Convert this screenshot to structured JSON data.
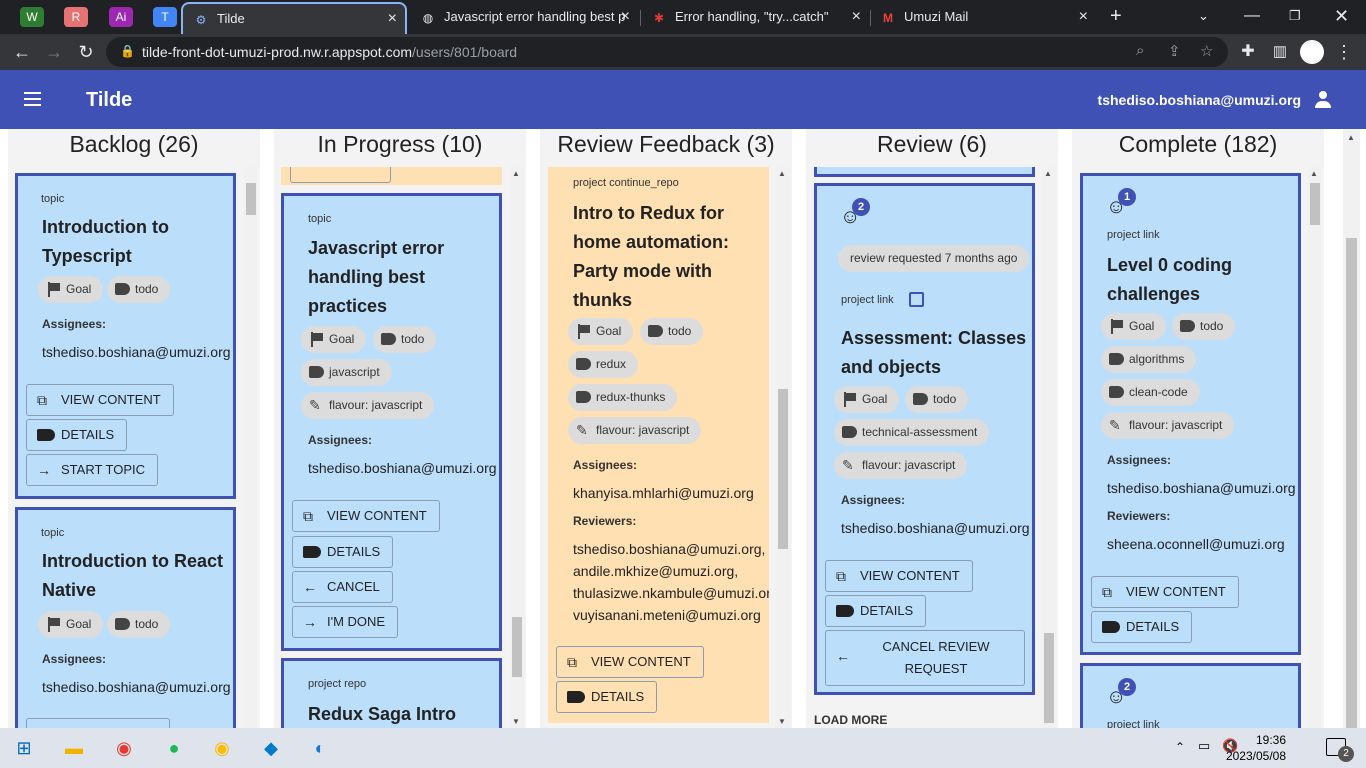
{
  "browser": {
    "pinned_tabs": [
      {
        "label": "W",
        "color": "#2e7d32"
      },
      {
        "label": "R",
        "color": "#e57373"
      },
      {
        "label": "Ai",
        "color": "#9c27b0"
      },
      {
        "label": "T",
        "color": "#4285f4"
      }
    ],
    "tabs": [
      {
        "title": "Tilde",
        "active": true
      },
      {
        "title": "Javascript error handling best p",
        "active": false
      },
      {
        "title": "Error handling, \"try...catch\"",
        "active": false
      },
      {
        "title": "Umuzi Mail",
        "active": false
      }
    ],
    "url_host": "tilde-front-dot-umuzi-prod.nw.r.appspot.com",
    "url_path": "/users/801/board"
  },
  "app": {
    "title": "Tilde",
    "user_email": "tshediso.boshiana@umuzi.org"
  },
  "columns": [
    {
      "title": "Backlog (26)"
    },
    {
      "title": "In Progress (10)"
    },
    {
      "title": "Review Feedback (3)"
    },
    {
      "title": "Review (6)"
    },
    {
      "title": "Complete (182)"
    }
  ],
  "backlog": [
    {
      "type": "topic",
      "title": "Introduction to Typescript",
      "tags": [
        "Goal",
        "todo"
      ],
      "assignees_label": "Assignees:",
      "assignees": "tshediso.boshiana@umuzi.org",
      "buttons": [
        "VIEW CONTENT",
        "DETAILS",
        "START TOPIC"
      ]
    },
    {
      "type": "topic",
      "title": "Introduction to React Native",
      "tags": [
        "Goal",
        "todo"
      ],
      "assignees_label": "Assignees:",
      "assignees": "tshediso.boshiana@umuzi.org"
    }
  ],
  "in_progress": [
    {
      "type": "topic",
      "title": "Javascript error handling best practices",
      "tags": [
        "Goal",
        "todo",
        "javascript",
        "flavour: javascript"
      ],
      "assignees_label": "Assignees:",
      "assignees": "tshediso.boshiana@umuzi.org",
      "buttons": [
        "VIEW CONTENT",
        "DETAILS",
        "CANCEL",
        "I'M DONE"
      ]
    },
    {
      "type": "project repo",
      "title": "Redux Saga Intro"
    }
  ],
  "review_feedback": [
    {
      "type": "project continue_repo",
      "title": "Intro to Redux for home automation: Party mode with thunks",
      "tags": [
        "Goal",
        "todo",
        "redux",
        "redux-thunks",
        "flavour: javascript"
      ],
      "assignees_label": "Assignees:",
      "assignees": "khanyisa.mhlarhi@umuzi.org",
      "reviewers_label": "Reviewers:",
      "reviewers": [
        "tshediso.boshiana@umuzi.org,",
        "andile.mkhize@umuzi.org,",
        "thulasizwe.nkambule@umuzi.org,",
        "vuyisanani.meteni@umuzi.org"
      ],
      "buttons": [
        "VIEW CONTENT",
        "DETAILS"
      ]
    }
  ],
  "review": [
    {
      "badge": "2",
      "status": "review requested 7 months ago",
      "type": "project link",
      "title": "Assessment: Classes and objects",
      "tags": [
        "Goal",
        "todo",
        "technical-assessment",
        "flavour: javascript"
      ],
      "assignees_label": "Assignees:",
      "assignees": "tshediso.boshiana@umuzi.org",
      "buttons": [
        "VIEW CONTENT",
        "DETAILS",
        "CANCEL REVIEW REQUEST"
      ]
    }
  ],
  "review_load_more": "LOAD MORE",
  "complete": [
    {
      "badge": "1",
      "type": "project link",
      "title": "Level 0 coding challenges",
      "tags": [
        "Goal",
        "todo",
        "algorithms",
        "clean-code",
        "flavour: javascript"
      ],
      "assignees_label": "Assignees:",
      "assignees": "tshediso.boshiana@umuzi.org",
      "reviewers_label": "Reviewers:",
      "reviewers": "sheena.oconnell@umuzi.org",
      "buttons": [
        "VIEW CONTENT",
        "DETAILS"
      ]
    },
    {
      "badge": "2",
      "type": "project link"
    }
  ],
  "taskbar": {
    "time": "19:36",
    "date": "2023/05/08",
    "notifications": "2"
  }
}
